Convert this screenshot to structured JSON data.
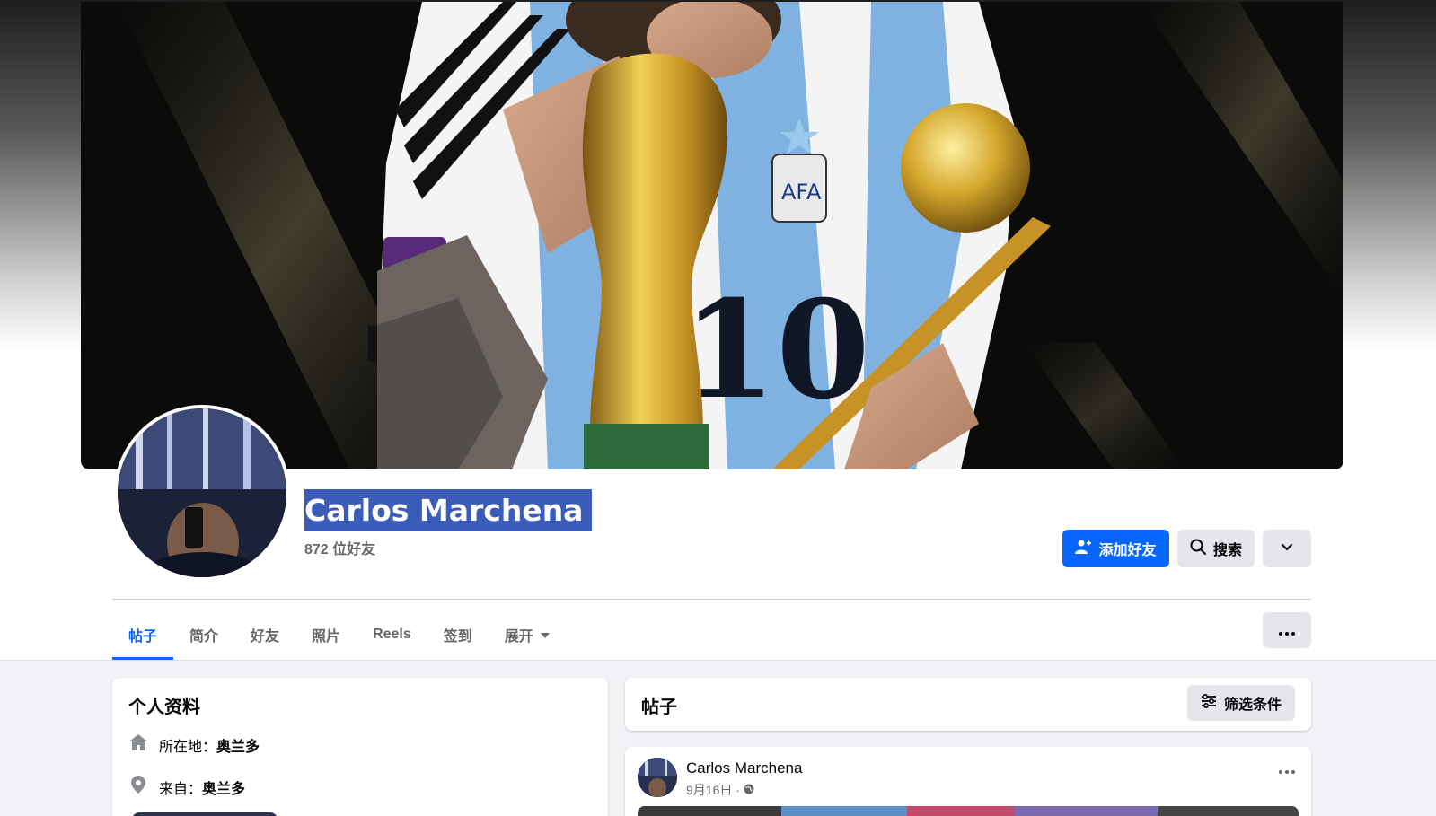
{
  "profile": {
    "name": "Carlos Marchena",
    "friends": "872 位好友"
  },
  "actions": {
    "add_friend": "添加好友",
    "search": "搜索"
  },
  "tabs": [
    {
      "label": "帖子",
      "active": true
    },
    {
      "label": "简介"
    },
    {
      "label": "好友"
    },
    {
      "label": "照片"
    },
    {
      "label": "Reels"
    },
    {
      "label": "签到"
    },
    {
      "label": "展开"
    }
  ],
  "intro": {
    "title": "个人资料",
    "lives_label": "所在地：",
    "lives_value": "奥兰多",
    "from_label": "来自：",
    "from_value": "奥兰多"
  },
  "posts": {
    "title": "帖子",
    "filter": "筛选条件",
    "items": [
      {
        "author": "Carlos Marchena",
        "date": "9月16日 ·"
      }
    ]
  },
  "colors": {
    "accent": "#0866ff",
    "secondary_button": "#e4e6eb",
    "page_bg": "#f0f2f5",
    "name_highlight": "#3b5cb8"
  }
}
